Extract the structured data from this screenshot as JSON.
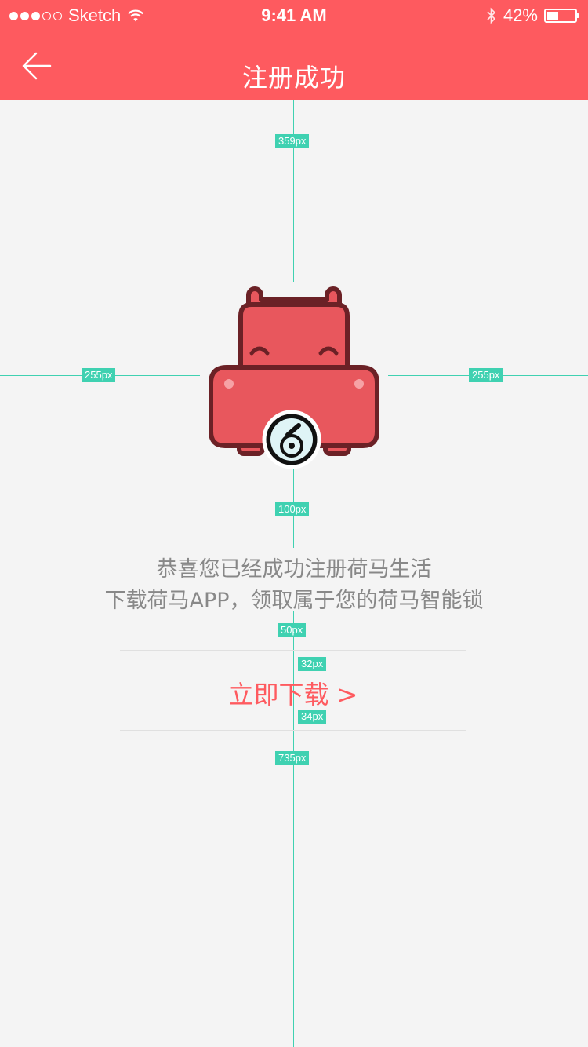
{
  "status_bar": {
    "carrier": "Sketch",
    "time": "9:41 AM",
    "battery": "42%",
    "battery_level": 0.42,
    "icons": [
      "signal-dots-icon",
      "wifi-icon",
      "bluetooth-icon",
      "battery-icon"
    ]
  },
  "nav": {
    "back_icon": "arrow-left-icon",
    "title": "注册成功"
  },
  "measurements": {
    "top_gap": "359px",
    "left_gap": "255px",
    "right_gap": "255px",
    "icon_to_text": "100px",
    "text_to_divider": "50px",
    "divider_to_link": "32px",
    "link_to_divider": "34px",
    "bottom_gap": "735px"
  },
  "main": {
    "illustration": "hippo-lock-icon",
    "message_line1": "恭喜您已经成功注册荷马生活",
    "message_line2": "下载荷马APP，领取属于您的荷马智能锁",
    "download_label": "立即下载 >"
  },
  "colors": {
    "brand": "#fe5a5f",
    "guide": "#3fd1b1",
    "hippo_body": "#e8575d",
    "hippo_outline": "#6b2126",
    "text_gray": "#888888",
    "background": "#f4f4f4"
  }
}
